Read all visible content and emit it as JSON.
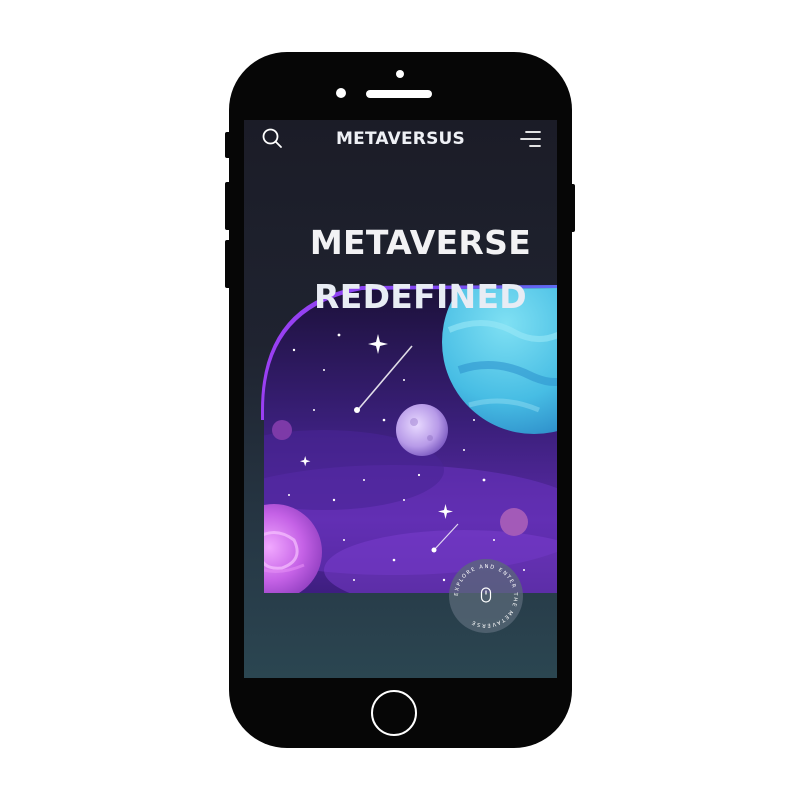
{
  "app": {
    "brand": "METAVERSUS"
  },
  "nav": {
    "search_icon": "search-icon",
    "menu_icon": "menu-icon"
  },
  "hero": {
    "line1": "METAVERSE",
    "line2": "REDEFINED"
  },
  "scroll_badge": {
    "ring_text": "EXPLORE AND ENTER THE METAVERSE",
    "icon": "mouse-icon"
  },
  "colors": {
    "accent_purple": "#8a3cf0",
    "planet_blue": "#4fc4e6",
    "screen_bg": "#1f2330"
  }
}
